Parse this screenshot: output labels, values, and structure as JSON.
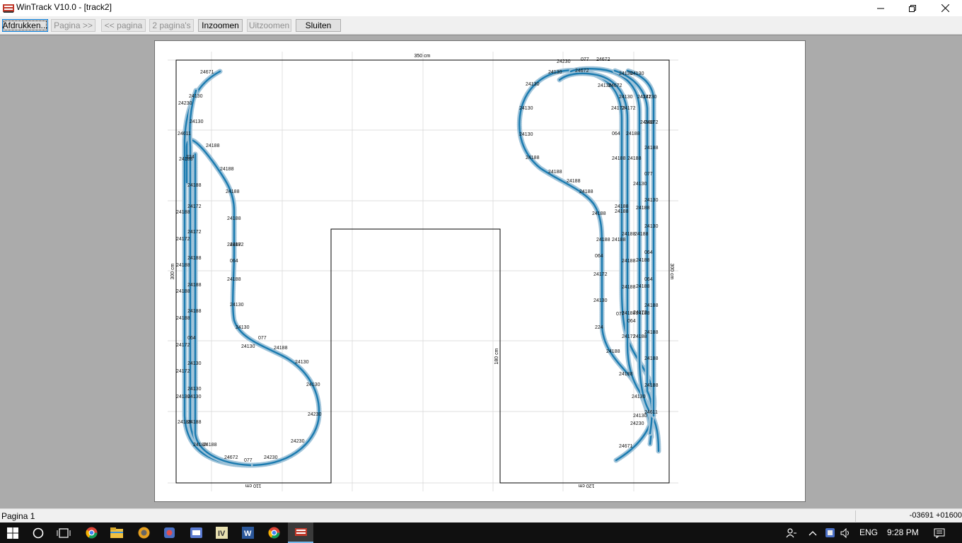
{
  "window": {
    "title": "WinTrack  V10.0 - [track2]",
    "app_icon": "wintrack-app-icon",
    "controls": [
      "minimize-icon",
      "restore-icon",
      "close-icon"
    ]
  },
  "toolbar": {
    "buttons": [
      {
        "label": "Afdrukken...",
        "enabled": true,
        "focused": true
      },
      {
        "label": "Pagina >>",
        "enabled": false
      },
      {
        "label": "<< pagina",
        "enabled": false
      },
      {
        "label": "2 pagina's",
        "enabled": false
      },
      {
        "label": "Inzoomen",
        "enabled": true
      },
      {
        "label": "Uitzoomen",
        "enabled": false
      },
      {
        "label": "Sluiten",
        "enabled": true
      }
    ]
  },
  "plan": {
    "dimensions": {
      "top_width": "350 cm",
      "left_height": "300 cm",
      "right_height": "300 cm",
      "center_height": "180 cm",
      "bottom_left_width": "110 cm",
      "bottom_right_width": "120 cm"
    },
    "track_color": "#1a7bb0",
    "grid_color": "#cfcfcf",
    "left_labels": [
      "24671",
      "24130",
      "24230",
      "24130",
      "24611",
      "24188",
      "24188",
      "24188",
      "24188",
      "24188",
      "24188",
      "24188",
      "24188",
      "24188",
      "24172",
      "24172",
      "24172",
      "24188",
      "24188",
      "24188",
      "24188",
      "24188",
      "24188",
      "24172",
      "064",
      "24172",
      "24130",
      "24130",
      "24130",
      "24130",
      "24188",
      "24188",
      "24188",
      "24188",
      "24130",
      "064",
      "24172",
      "24130",
      "24130",
      "077",
      "24188",
      "24130",
      "24130",
      "24230",
      "24230",
      "24672",
      "077",
      "24230",
      "224"
    ],
    "right_labels": [
      "24230",
      "077",
      "24672",
      "24130",
      "24672",
      "24130",
      "24130",
      "24672",
      "24130",
      "24130",
      "24130",
      "24130",
      "24130",
      "24130",
      "24172",
      "24172",
      "24172",
      "24172",
      "064",
      "24188",
      "24188",
      "24188",
      "24188",
      "24188",
      "24188",
      "24188",
      "24188",
      "24188",
      "24188",
      "24188",
      "24130",
      "24188",
      "077",
      "24130",
      "24130",
      "064",
      "064",
      "24188",
      "24188",
      "24188",
      "24188",
      "24188",
      "24188",
      "24172",
      "064",
      "24188",
      "24188",
      "24188",
      "24188",
      "24188",
      "24188",
      "24188",
      "24188",
      "24188",
      "24130",
      "224",
      "077",
      "064",
      "24172",
      "24172",
      "24188",
      "24188",
      "24188",
      "24611",
      "24130",
      "24230",
      "24130",
      "24671"
    ]
  },
  "statusbar": {
    "page": "Pagina 1",
    "coords": "-03691  +01600"
  },
  "taskbar": {
    "icons": [
      "windows-start-icon",
      "cortana-search-icon",
      "task-view-icon",
      "chrome-icon",
      "file-explorer-icon",
      "app-icon-1",
      "app-icon-2",
      "app-icon-3",
      "app-icon-4",
      "word-icon",
      "chrome-icon-2",
      "wintrack-task-icon"
    ],
    "language": "ENG",
    "time": "9:28 PM"
  }
}
